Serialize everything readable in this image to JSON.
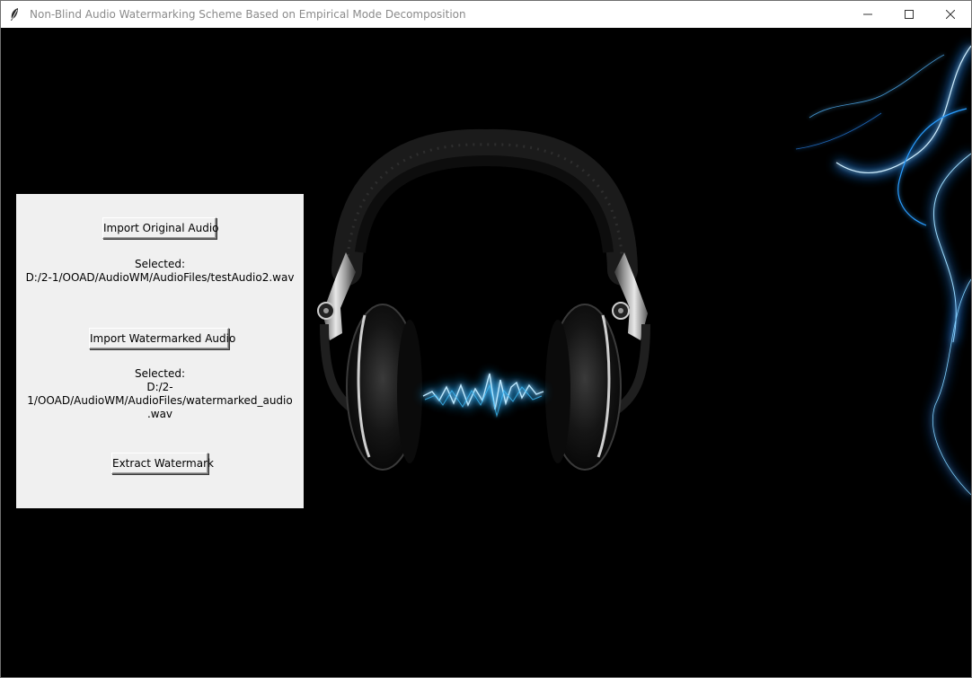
{
  "window": {
    "title": "Non-Blind Audio Watermarking Scheme Based on Empirical Mode Decomposition",
    "app_icon": "feather-icon",
    "controls": [
      "minimize-icon",
      "maximize-icon",
      "close-icon"
    ]
  },
  "panel": {
    "import_original_label": "Import Original Audio",
    "original_selected_label": "Selected:",
    "original_selected_path": "D:/2-1/OOAD/AudioWM/AudioFiles/testAudio2.wav",
    "import_watermarked_label": "Import Watermarked Audio",
    "watermarked_selected_label": "Selected:",
    "watermarked_selected_path_line1": "D:/2-1/OOAD/AudioWM/AudioFiles/watermarked_audio",
    "watermarked_selected_path_line2": ".wav",
    "extract_label": "Extract Watermark"
  },
  "background": {
    "image": "headphones-with-blue-sound-wave",
    "accent_color": "#1aa8ff"
  }
}
